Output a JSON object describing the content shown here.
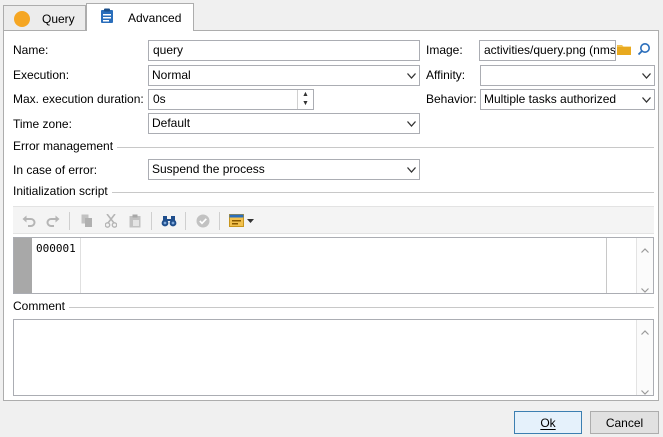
{
  "tabs": [
    {
      "label": "Query",
      "icon": "orange-circle-icon"
    },
    {
      "label": "Advanced",
      "icon": "clipboard-icon"
    }
  ],
  "form": {
    "name_label": "Name:",
    "name_value": "query",
    "image_label": "Image:",
    "image_value": "activities/query.png (nms",
    "execution_label": "Execution:",
    "execution_value": "Normal",
    "affinity_label": "Affinity:",
    "affinity_value": "",
    "max_duration_label": "Max. execution duration:",
    "max_duration_value": "0s",
    "behavior_label": "Behavior:",
    "behavior_value": "Multiple tasks authorized",
    "timezone_label": "Time zone:",
    "timezone_value": "Default"
  },
  "error_section": {
    "title": "Error management",
    "in_case_label": "In case of error:",
    "in_case_value": "Suspend the process"
  },
  "script_section": {
    "title": "Initialization script",
    "line_number": "000001"
  },
  "comment_section": {
    "title": "Comment",
    "value": ""
  },
  "buttons": {
    "ok": "Ok",
    "cancel": "Cancel"
  },
  "colors": {
    "accent_orange": "#f5a623",
    "find_blue": "#1f4e8c",
    "folder_yellow": "#f2c14e"
  }
}
